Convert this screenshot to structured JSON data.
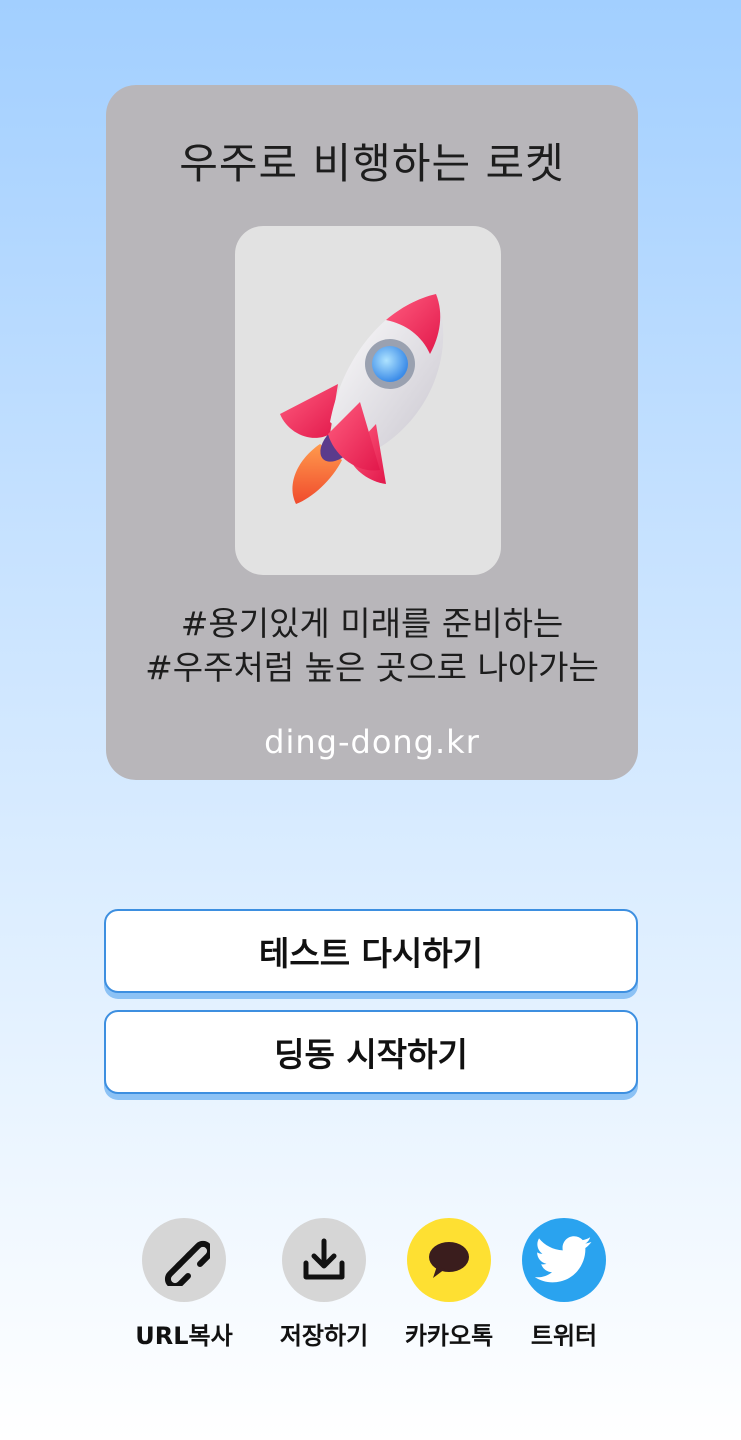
{
  "result_card": {
    "title": "우주로 비행하는 로켓",
    "image": "rocket",
    "tags": [
      "#용기있게 미래를 준비하는",
      "#우주처럼 높은 곳으로 나아가는"
    ],
    "site": "ding-dong.kr"
  },
  "buttons": {
    "retry_label": "테스트 다시하기",
    "start_label": "딩동 시작하기"
  },
  "share": {
    "items": [
      {
        "label": "URL복사",
        "icon": "link-icon",
        "color": "#d6d6d6"
      },
      {
        "label": "저장하기",
        "icon": "download-icon",
        "color": "#d6d6d6"
      },
      {
        "label": "카카오톡",
        "icon": "kakaotalk-icon",
        "color": "#fee032"
      },
      {
        "label": "트위터",
        "icon": "twitter-icon",
        "color": "#2aa3ef"
      }
    ]
  },
  "colors": {
    "card_bg": "#b8b6ba",
    "button_border": "#3d8fe0",
    "button_shadow": "#8cc2f5"
  }
}
